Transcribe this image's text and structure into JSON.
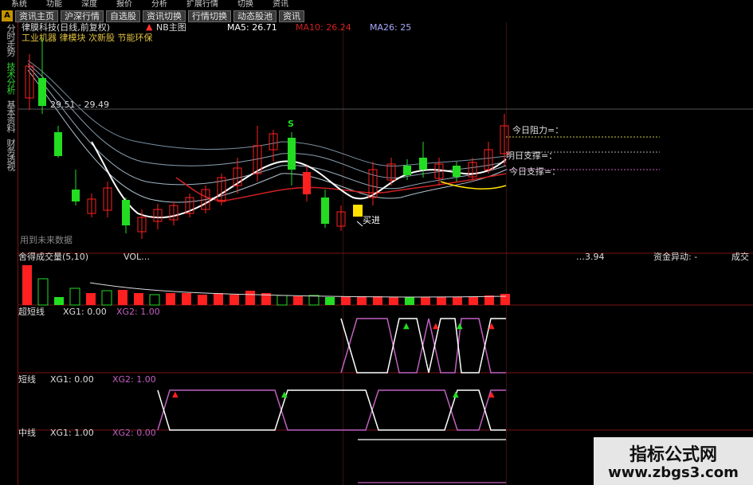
{
  "menu": [
    "系统",
    "功能",
    "深度",
    "报价",
    "分析",
    "扩展行情",
    "切换",
    "资讯"
  ],
  "tabs": [
    "资讯主页",
    "沪深行情",
    "自选股",
    "资讯切换",
    "行情切换",
    "动态股池",
    "资讯"
  ],
  "tab_a": "A",
  "sidebar": [
    {
      "label": "分时走势",
      "active": false
    },
    {
      "label": "技术分析",
      "active": true
    },
    {
      "label": "基本资料",
      "active": false
    },
    {
      "label": "财务透视",
      "active": false
    }
  ],
  "main": {
    "stock_title": "律膜科技(日线,前复权)",
    "indicator": "NB主图",
    "ma5": "MA5: 26.71",
    "ma10": "MA10: 26.24",
    "ma26": "MA26: 25",
    "concept": "工业机器 律模块 次新股 节能环保",
    "price_range": "29.51 - 29.49",
    "signal_s": "S",
    "buy_label": "买进",
    "resistance_today": "今日阻力=：",
    "support_tomorrow": "明日支撑=：",
    "support_today": "今日支撑=：",
    "note": "用到未来数据"
  },
  "volume": {
    "label": "舍得成交量(5,10)",
    "value": "VOL…",
    "value2": "…3.94",
    "fund_label": "资金异动: -",
    "extra": "成交"
  },
  "panels": [
    {
      "name": "超短线",
      "xg1": "XG1: 0.00",
      "xg2": "XG2: 1.00"
    },
    {
      "name": "短线",
      "xg1": "XG1: 0.00",
      "xg2": "XG2: 1.00"
    },
    {
      "name": "中线",
      "xg1": "XG1: 1.00",
      "xg2": "XG2: 0.00"
    }
  ],
  "colors": {
    "up": "#ff2020",
    "down": "#22dd22",
    "ma5": "#ffffff",
    "ma10": "#cc2020",
    "accent": "#c060c0",
    "yellow": "#ffe000"
  },
  "watermark": {
    "title": "指标公式网",
    "url": "www.zbgs3.com"
  }
}
